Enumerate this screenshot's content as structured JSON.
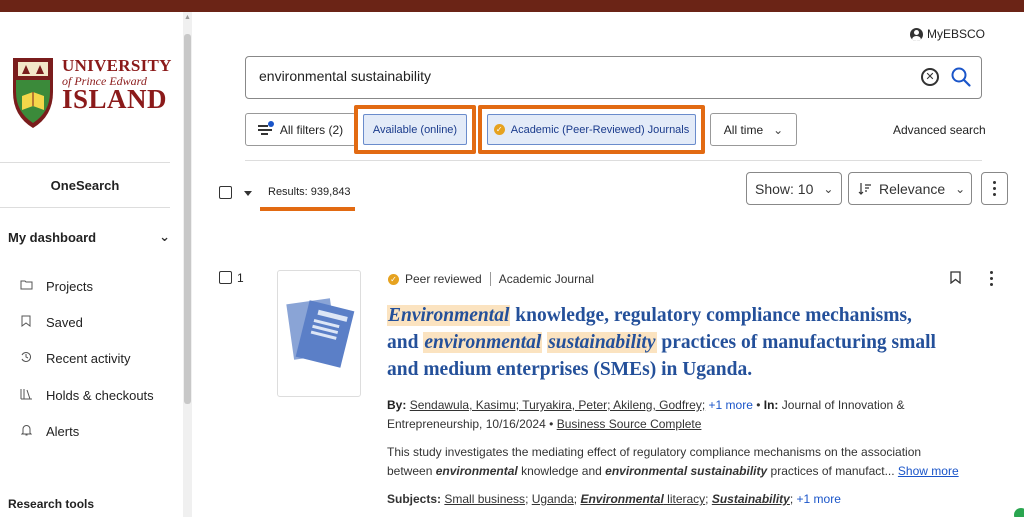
{
  "sidebar": {
    "logo": {
      "line1": "UNIVERSITY",
      "line2": "of Prince Edward",
      "line3": "ISLAND"
    },
    "onesearch": "OneSearch",
    "dashboard": "My dashboard",
    "items": [
      {
        "label": "Projects",
        "icon": "folder-icon"
      },
      {
        "label": "Saved",
        "icon": "bookmark-icon"
      },
      {
        "label": "Recent activity",
        "icon": "history-icon"
      },
      {
        "label": "Holds & checkouts",
        "icon": "books-icon"
      },
      {
        "label": "Alerts",
        "icon": "bell-icon"
      }
    ],
    "research_tools": "Research tools"
  },
  "header": {
    "account": "MyEBSCO"
  },
  "search": {
    "query": "environmental sustainability"
  },
  "filters": {
    "all_filters": "All filters (2)",
    "available": "Available (online)",
    "peer_reviewed": "Academic (Peer-Reviewed) Journals",
    "all_time": "All time",
    "advanced": "Advanced search"
  },
  "results_bar": {
    "count": "Results: 939,843",
    "show": "Show: 10",
    "sort": "Relevance"
  },
  "result": {
    "number": "1",
    "peer": "Peer reviewed",
    "type": "Academic Journal",
    "title": {
      "w1": "Environmental",
      "t1": " knowledge, regulatory compliance mechanisms, and ",
      "w2": "environmental",
      "t2": " ",
      "w3": "sustainability",
      "t3": " practices of manufacturing small and medium enterprises (SMEs) in Uganda."
    },
    "meta": {
      "by_label": "By:",
      "authors": "Sendawula, Kasimu; Turyakira, Peter; Akileng, Godfrey;",
      "more_authors": "+1 more",
      "in_label": "In:",
      "source": "Journal of Innovation & Entrepreneurship, 10/16/2024",
      "database": "Business Source Complete"
    },
    "abstract": {
      "a1": "This study investigates the mediating effect of regulatory compliance mechanisms on the association between ",
      "b1": "environmental",
      "a2": " knowledge and ",
      "b2": "environmental sustainability",
      "a3": " practices of manufact...",
      "show_more": "Show more"
    },
    "subjects": {
      "label": "Subjects:",
      "s1": "Small business",
      "s2": "Uganda",
      "s3b": "Environmental",
      "s3": " literacy",
      "s4": "Sustainability",
      "more": "+1 more"
    }
  },
  "colors": {
    "accent": "#e26a12",
    "link": "#24509a",
    "brand": "#6b2416",
    "highlight": "#fbe3c0"
  }
}
